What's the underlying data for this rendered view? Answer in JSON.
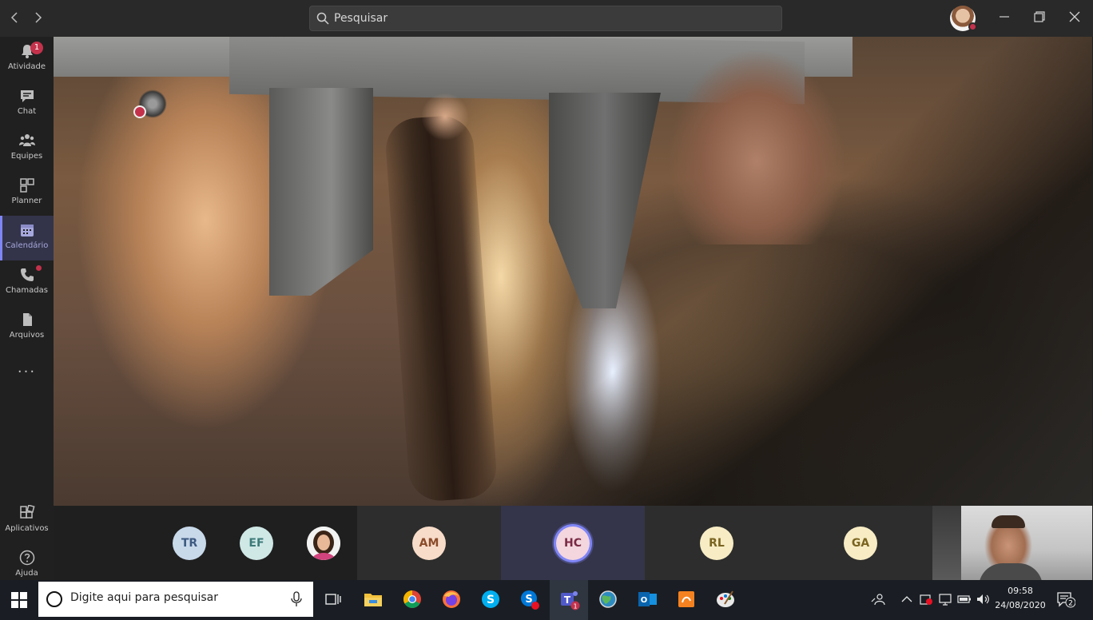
{
  "titlebar": {
    "search_placeholder": "Pesquisar",
    "back_icon": "chevron-left-icon",
    "forward_icon": "chevron-right-icon"
  },
  "rail": {
    "items": [
      {
        "label": "Atividade",
        "icon": "bell-icon",
        "badge": "1"
      },
      {
        "label": "Chat",
        "icon": "chat-icon"
      },
      {
        "label": "Equipes",
        "icon": "teams-icon"
      },
      {
        "label": "Planner",
        "icon": "planner-icon"
      },
      {
        "label": "Calendário",
        "icon": "calendar-icon",
        "active": true
      },
      {
        "label": "Chamadas",
        "icon": "phone-icon",
        "dot": true
      },
      {
        "label": "Arquivos",
        "icon": "file-icon"
      }
    ],
    "more": "...",
    "bottom": [
      {
        "label": "Aplicativos",
        "icon": "apps-icon"
      },
      {
        "label": "Ajuda",
        "icon": "help-icon"
      }
    ]
  },
  "participants": [
    {
      "initials": "TR",
      "bg": "#c8d9ea",
      "fg": "#3d5a80"
    },
    {
      "initials": "EF",
      "bg": "#cfe8e6",
      "fg": "#3d7a78"
    },
    {
      "initials": "",
      "bg": "#ffffff",
      "fg": "#000000",
      "photo": true
    },
    {
      "initials": "AM",
      "bg": "#f7dcc9",
      "fg": "#8a4b2a"
    },
    {
      "initials": "HC",
      "bg": "#f3d6de",
      "fg": "#7a2a44"
    },
    {
      "initials": "RL",
      "bg": "#f7ecc4",
      "fg": "#7a6420"
    },
    {
      "initials": "GA",
      "bg": "#f7ecc4",
      "fg": "#7a6420"
    }
  ],
  "taskbar": {
    "search_placeholder": "Digite aqui para pesquisar",
    "time": "09:58",
    "date": "24/08/2020",
    "notifications": "2",
    "teams_badge": "1"
  },
  "colors": {
    "accent": "#7f85f5",
    "alert": "#c4314b",
    "rail_bg": "#202020",
    "titlebar_bg": "#292929"
  }
}
